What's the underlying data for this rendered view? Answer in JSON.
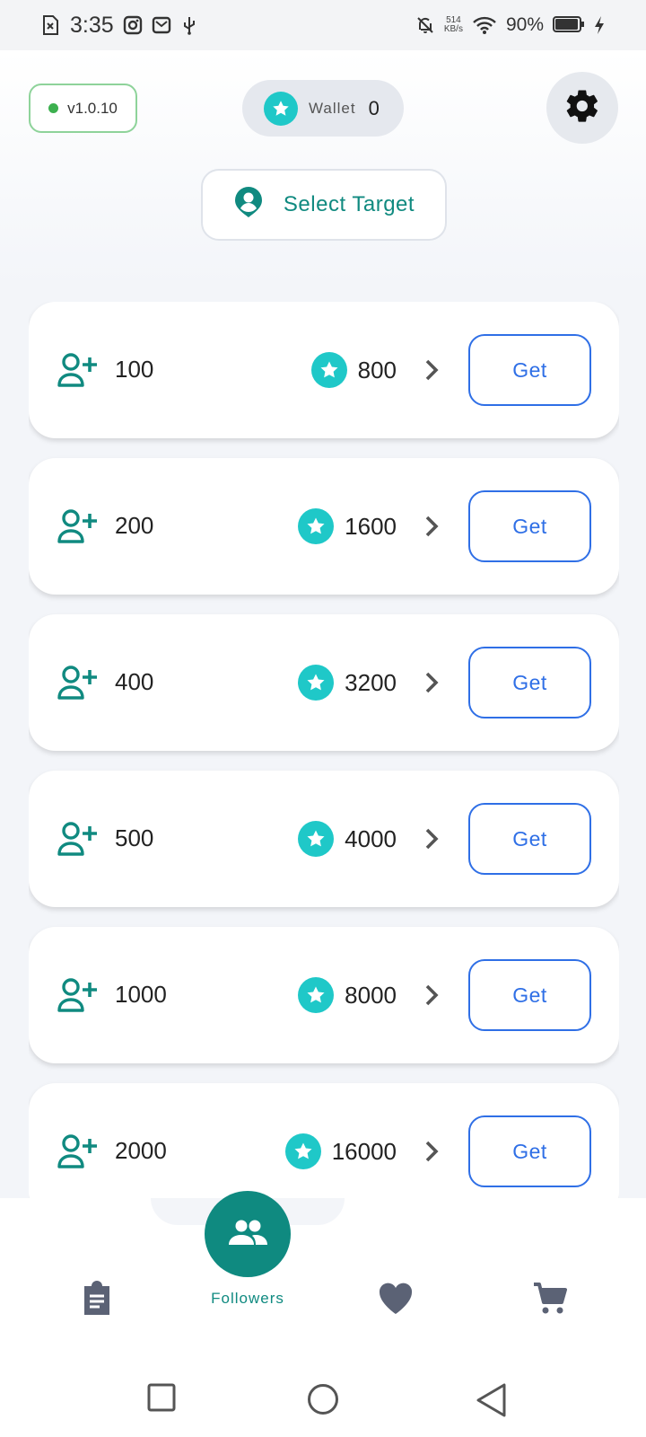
{
  "status_bar": {
    "time": "3:35",
    "net_speed_value": "514",
    "net_speed_unit": "KB/s",
    "battery_percent": "90%",
    "icons": [
      "sim-icon",
      "instagram-icon",
      "mail-icon",
      "usb-icon",
      "mute-icon",
      "wifi-icon",
      "battery-icon",
      "charging-icon"
    ]
  },
  "header": {
    "version": "v1.0.10",
    "wallet_label": "Wallet",
    "wallet_value": "0",
    "settings_icon": "gear-icon",
    "select_target_label": "Select Target"
  },
  "packages": [
    {
      "followers": "100",
      "price": "800",
      "action": "Get"
    },
    {
      "followers": "200",
      "price": "1600",
      "action": "Get"
    },
    {
      "followers": "400",
      "price": "3200",
      "action": "Get"
    },
    {
      "followers": "500",
      "price": "4000",
      "action": "Get"
    },
    {
      "followers": "1000",
      "price": "8000",
      "action": "Get"
    },
    {
      "followers": "2000",
      "price": "16000",
      "action": "Get"
    }
  ],
  "bottom_nav": {
    "items": [
      {
        "icon": "clipboard-icon"
      },
      {
        "icon": "people-icon",
        "label": "Followers",
        "active": true
      },
      {
        "icon": "heart-icon"
      },
      {
        "icon": "cart-icon"
      }
    ]
  },
  "colors": {
    "accent_teal": "#0f8a80",
    "coin": "#1fc8c8",
    "button_blue": "#2f6fe6",
    "version_border": "#8ed39a"
  }
}
